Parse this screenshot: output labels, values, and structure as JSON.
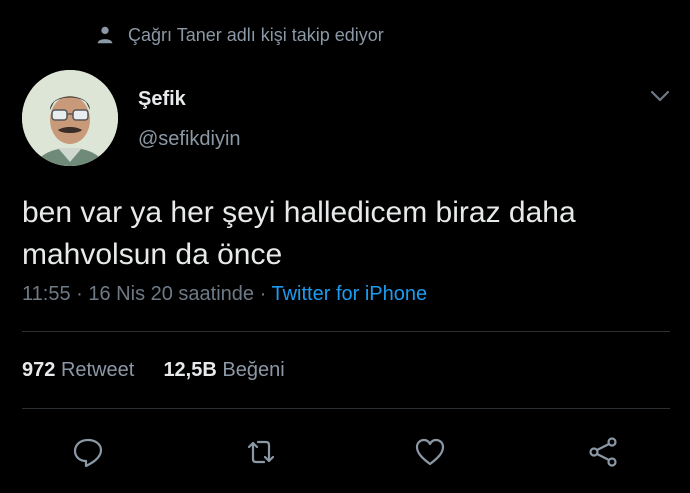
{
  "context": {
    "text": "Çağrı Taner adlı kişi takip ediyor",
    "icon": "person-icon"
  },
  "author": {
    "name": "Şefik",
    "handle": "@sefikdiyin"
  },
  "tweet": {
    "text": "ben var ya her şeyi halledicem biraz daha mahvolsun da önce"
  },
  "meta": {
    "time": "11:55",
    "date": "16 Nis 20 saatinde",
    "separator": "·",
    "source": "Twitter for iPhone"
  },
  "stats": {
    "retweets_count": "972",
    "retweets_label": "Retweet",
    "likes_count": "12,5B",
    "likes_label": "Beğeni"
  },
  "actions": {
    "reply": "reply-icon",
    "retweet": "retweet-icon",
    "like": "heart-icon",
    "share": "share-icon"
  },
  "colors": {
    "background": "#000000",
    "text": "#e7e9ea",
    "secondary": "#8b98a5",
    "link": "#1d9bf0"
  }
}
